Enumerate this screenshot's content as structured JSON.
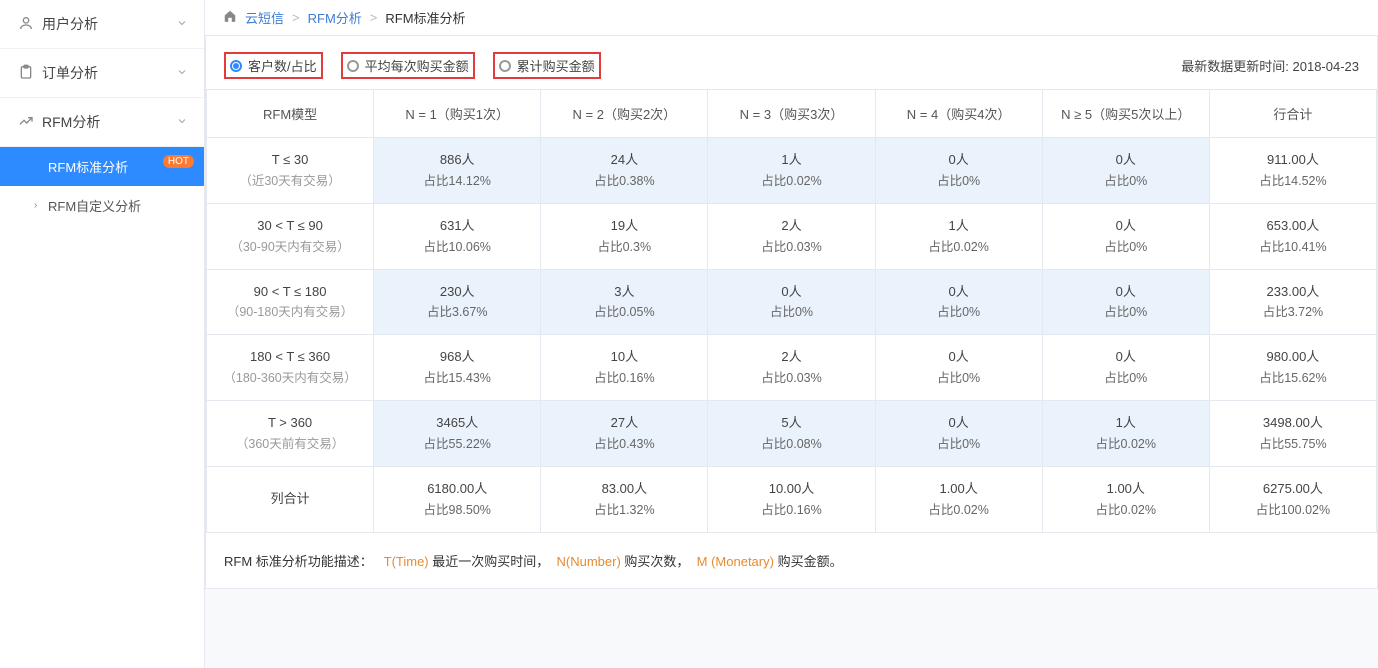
{
  "sidebar": {
    "groups": [
      {
        "label": "用户分析"
      },
      {
        "label": "订单分析"
      },
      {
        "label": "RFM分析",
        "children": [
          {
            "label": "RFM标准分析",
            "badge": "HOT"
          },
          {
            "label": "RFM自定义分析"
          }
        ]
      }
    ]
  },
  "breadcrumb": [
    "云短信",
    "RFM分析",
    "RFM标准分析"
  ],
  "tabs": {
    "options": [
      "客户数/占比",
      "平均每次购买金额",
      "累计购买金额"
    ],
    "selected": 0
  },
  "update": {
    "label": "最新数据更新时间: ",
    "date": "2018-04-23"
  },
  "table": {
    "columns": [
      "RFM模型",
      "N = 1（购买1次）",
      "N = 2（购买2次）",
      "N = 3（购买3次）",
      "N = 4（购买4次）",
      "N ≥ 5（购买5次以上）",
      "行合计"
    ],
    "rowHeaders": [
      {
        "title": "T ≤ 30",
        "sub": "（近30天有交易）"
      },
      {
        "title": "30 < T ≤ 90",
        "sub": "（30-90天内有交易）"
      },
      {
        "title": "90 < T ≤ 180",
        "sub": "（90-180天内有交易）"
      },
      {
        "title": "180 < T ≤ 360",
        "sub": "（180-360天内有交易）"
      },
      {
        "title": "T > 360",
        "sub": "（360天前有交易）"
      },
      {
        "title": "列合计",
        "sub": ""
      }
    ],
    "cells": [
      [
        {
          "v": "886人",
          "p": "占比14.12%"
        },
        {
          "v": "24人",
          "p": "占比0.38%"
        },
        {
          "v": "1人",
          "p": "占比0.02%"
        },
        {
          "v": "0人",
          "p": "占比0%"
        },
        {
          "v": "0人",
          "p": "占比0%"
        },
        {
          "v": "911.00人",
          "p": "占比14.52%"
        }
      ],
      [
        {
          "v": "631人",
          "p": "占比10.06%"
        },
        {
          "v": "19人",
          "p": "占比0.3%"
        },
        {
          "v": "2人",
          "p": "占比0.03%"
        },
        {
          "v": "1人",
          "p": "占比0.02%"
        },
        {
          "v": "0人",
          "p": "占比0%"
        },
        {
          "v": "653.00人",
          "p": "占比10.41%"
        }
      ],
      [
        {
          "v": "230人",
          "p": "占比3.67%"
        },
        {
          "v": "3人",
          "p": "占比0.05%"
        },
        {
          "v": "0人",
          "p": "占比0%"
        },
        {
          "v": "0人",
          "p": "占比0%"
        },
        {
          "v": "0人",
          "p": "占比0%"
        },
        {
          "v": "233.00人",
          "p": "占比3.72%"
        }
      ],
      [
        {
          "v": "968人",
          "p": "占比15.43%"
        },
        {
          "v": "10人",
          "p": "占比0.16%"
        },
        {
          "v": "2人",
          "p": "占比0.03%"
        },
        {
          "v": "0人",
          "p": "占比0%"
        },
        {
          "v": "0人",
          "p": "占比0%"
        },
        {
          "v": "980.00人",
          "p": "占比15.62%"
        }
      ],
      [
        {
          "v": "3465人",
          "p": "占比55.22%"
        },
        {
          "v": "27人",
          "p": "占比0.43%"
        },
        {
          "v": "5人",
          "p": "占比0.08%"
        },
        {
          "v": "0人",
          "p": "占比0%"
        },
        {
          "v": "1人",
          "p": "占比0.02%"
        },
        {
          "v": "3498.00人",
          "p": "占比55.75%"
        }
      ],
      [
        {
          "v": "6180.00人",
          "p": "占比98.50%"
        },
        {
          "v": "83.00人",
          "p": "占比1.32%"
        },
        {
          "v": "10.00人",
          "p": "占比0.16%"
        },
        {
          "v": "1.00人",
          "p": "占比0.02%"
        },
        {
          "v": "1.00人",
          "p": "占比0.02%"
        },
        {
          "v": "6275.00人",
          "p": "占比100.02%"
        }
      ]
    ],
    "altRows": [
      0,
      2,
      4
    ]
  },
  "legend": {
    "prefix": "RFM 标准分析功能描述：",
    "items": [
      {
        "key": "T(Time) ",
        "desc": "最近一次购买时间"
      },
      {
        "key": "N(Number) ",
        "desc": "购买次数"
      },
      {
        "key": "M (Monetary) ",
        "desc": "购买金额"
      }
    ]
  },
  "chart_data": {
    "type": "table",
    "title": "RFM标准分析 — 客户数/占比",
    "row_labels": [
      "T ≤ 30",
      "30 < T ≤ 90",
      "90 < T ≤ 180",
      "180 < T ≤ 360",
      "T > 360",
      "列合计"
    ],
    "col_labels": [
      "N = 1",
      "N = 2",
      "N = 3",
      "N = 4",
      "N ≥ 5",
      "行合计"
    ],
    "counts": [
      [
        886,
        24,
        1,
        0,
        0,
        911
      ],
      [
        631,
        19,
        2,
        1,
        0,
        653
      ],
      [
        230,
        3,
        0,
        0,
        0,
        233
      ],
      [
        968,
        10,
        2,
        0,
        0,
        980
      ],
      [
        3465,
        27,
        5,
        0,
        1,
        3498
      ],
      [
        6180,
        83,
        10,
        1,
        1,
        6275
      ]
    ],
    "percent": [
      [
        14.12,
        0.38,
        0.02,
        0,
        0,
        14.52
      ],
      [
        10.06,
        0.3,
        0.03,
        0.02,
        0,
        10.41
      ],
      [
        3.67,
        0.05,
        0,
        0,
        0,
        3.72
      ],
      [
        15.43,
        0.16,
        0.03,
        0,
        0,
        15.62
      ],
      [
        55.22,
        0.43,
        0.08,
        0,
        0.02,
        55.75
      ],
      [
        98.5,
        1.32,
        0.16,
        0.02,
        0.02,
        100.02
      ]
    ]
  }
}
